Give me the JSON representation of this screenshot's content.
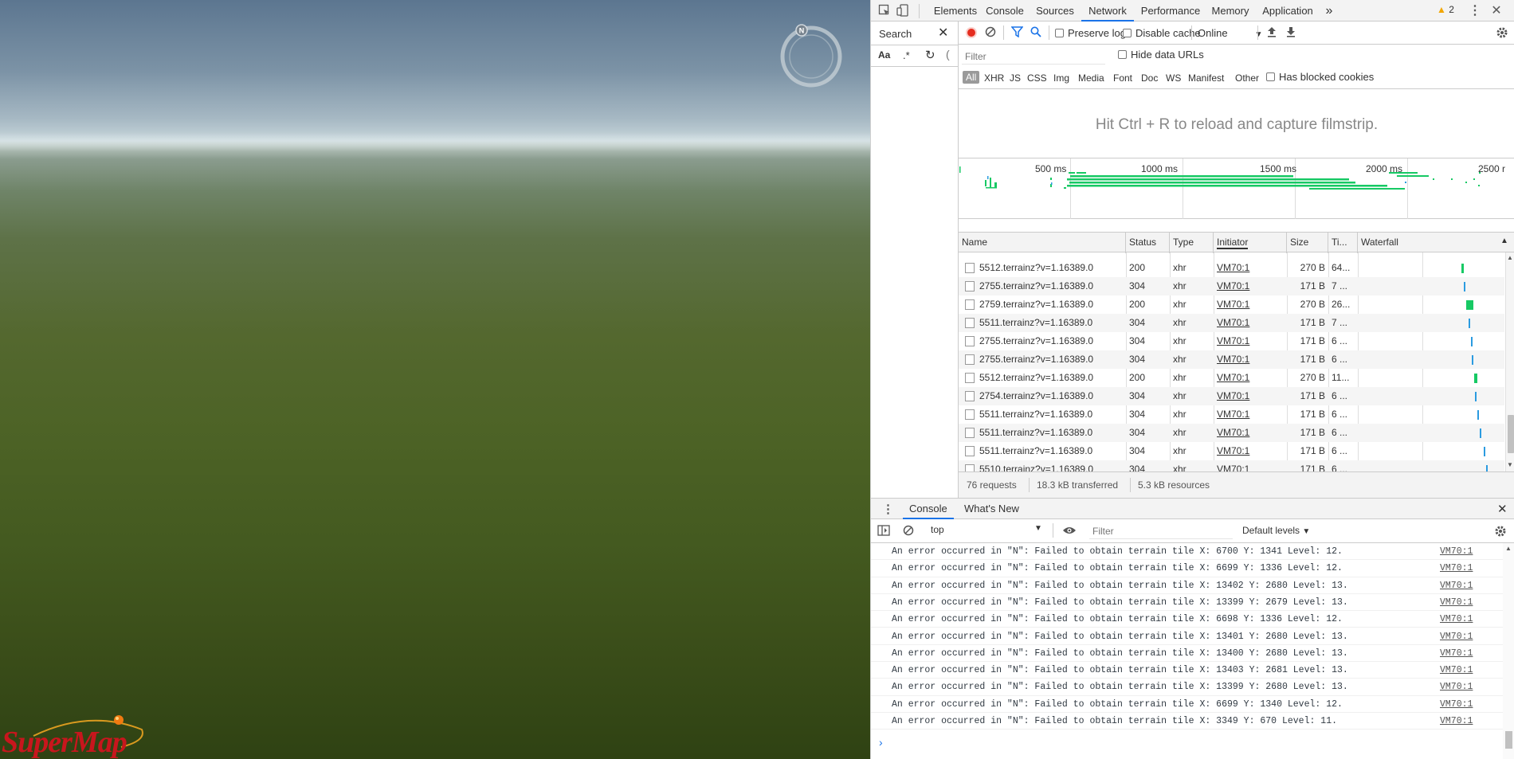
{
  "scene": {
    "compass_letter": "N",
    "logo_text": "SuperMap"
  },
  "devtools": {
    "tabs": [
      "Elements",
      "Console",
      "Sources",
      "Network",
      "Performance",
      "Memory",
      "Application"
    ],
    "active_tab": "Network",
    "more_tabs": "»",
    "warning_count": "2",
    "search": {
      "label": "Search",
      "case_toggle": "Aa",
      "regex_toggle": ".*"
    },
    "network": {
      "preserve_log": "Preserve log",
      "disable_cache": "Disable cache",
      "throttling": "Online",
      "filter_placeholder": "Filter",
      "hide_data_urls": "Hide data URLs",
      "type_filters": [
        "All",
        "XHR",
        "JS",
        "CSS",
        "Img",
        "Media",
        "Font",
        "Doc",
        "WS",
        "Manifest",
        "Other"
      ],
      "has_blocked_cookies": "Has blocked cookies",
      "filmstrip_hint": "Hit Ctrl + R to reload and capture filmstrip.",
      "overview_ticks": [
        "500 ms",
        "1000 ms",
        "1500 ms",
        "2000 ms",
        "2500 r"
      ],
      "columns": [
        "Name",
        "Status",
        "Type",
        "Initiator",
        "Size",
        "Ti...",
        "Waterfall"
      ],
      "rows": [
        {
          "name": "5512.terrainz?v=1.16389.0",
          "status": "200",
          "type": "xhr",
          "initiator": "VM70:1",
          "size": "270 B",
          "time": "64...",
          "wf": 0.56,
          "wf_color": "#17c964",
          "wf_w": 3
        },
        {
          "name": "2755.terrainz?v=1.16389.0",
          "status": "304",
          "type": "xhr",
          "initiator": "VM70:1",
          "size": "171 B",
          "time": "7 ...",
          "wf": 0.57,
          "wf_color": "#2b9be0",
          "wf_w": 2
        },
        {
          "name": "2759.terrainz?v=1.16389.0",
          "status": "200",
          "type": "xhr",
          "initiator": "VM70:1",
          "size": "270 B",
          "time": "26...",
          "wf": 0.58,
          "wf_color": "#17c964",
          "wf_w": 9
        },
        {
          "name": "5511.terrainz?v=1.16389.0",
          "status": "304",
          "type": "xhr",
          "initiator": "VM70:1",
          "size": "171 B",
          "time": "7 ...",
          "wf": 0.59,
          "wf_color": "#2b9be0",
          "wf_w": 2
        },
        {
          "name": "2755.terrainz?v=1.16389.0",
          "status": "304",
          "type": "xhr",
          "initiator": "VM70:1",
          "size": "171 B",
          "time": "6 ...",
          "wf": 0.6,
          "wf_color": "#2b9be0",
          "wf_w": 2
        },
        {
          "name": "2755.terrainz?v=1.16389.0",
          "status": "304",
          "type": "xhr",
          "initiator": "VM70:1",
          "size": "171 B",
          "time": "6 ...",
          "wf": 0.6,
          "wf_color": "#2b9be0",
          "wf_w": 2
        },
        {
          "name": "5512.terrainz?v=1.16389.0",
          "status": "200",
          "type": "xhr",
          "initiator": "VM70:1",
          "size": "270 B",
          "time": "11...",
          "wf": 0.61,
          "wf_color": "#17c964",
          "wf_w": 4
        },
        {
          "name": "2754.terrainz?v=1.16389.0",
          "status": "304",
          "type": "xhr",
          "initiator": "VM70:1",
          "size": "171 B",
          "time": "6 ...",
          "wf": 0.61,
          "wf_color": "#2b9be0",
          "wf_w": 2
        },
        {
          "name": "5511.terrainz?v=1.16389.0",
          "status": "304",
          "type": "xhr",
          "initiator": "VM70:1",
          "size": "171 B",
          "time": "6 ...",
          "wf": 0.62,
          "wf_color": "#2b9be0",
          "wf_w": 2
        },
        {
          "name": "5511.terrainz?v=1.16389.0",
          "status": "304",
          "type": "xhr",
          "initiator": "VM70:1",
          "size": "171 B",
          "time": "6 ...",
          "wf": 0.63,
          "wf_color": "#2b9be0",
          "wf_w": 2
        },
        {
          "name": "5511.terrainz?v=1.16389.0",
          "status": "304",
          "type": "xhr",
          "initiator": "VM70:1",
          "size": "171 B",
          "time": "6 ...",
          "wf": 0.65,
          "wf_color": "#2b9be0",
          "wf_w": 2
        },
        {
          "name": "5510.terrainz?v=1.16389.0",
          "status": "304",
          "type": "xhr",
          "initiator": "VM70:1",
          "size": "171 B",
          "time": "6 ...",
          "wf": 0.66,
          "wf_color": "#2b9be0",
          "wf_w": 2
        }
      ],
      "summary": {
        "requests": "76 requests",
        "transferred": "18.3 kB transferred",
        "resources": "5.3 kB resources"
      }
    },
    "drawer": {
      "tabs": [
        "Console",
        "What's New"
      ],
      "active_tab": "Console",
      "context": "top",
      "filter_placeholder": "Filter",
      "levels": "Default levels",
      "messages": [
        {
          "text": "An error occurred in \"N\": Failed to obtain terrain tile X: 6700 Y: 1341 Level: 12.",
          "source": "VM70:1"
        },
        {
          "text": "An error occurred in \"N\": Failed to obtain terrain tile X: 6699 Y: 1336 Level: 12.",
          "source": "VM70:1"
        },
        {
          "text": "An error occurred in \"N\": Failed to obtain terrain tile X: 13402 Y: 2680 Level: 13.",
          "source": "VM70:1"
        },
        {
          "text": "An error occurred in \"N\": Failed to obtain terrain tile X: 13399 Y: 2679 Level: 13.",
          "source": "VM70:1"
        },
        {
          "text": "An error occurred in \"N\": Failed to obtain terrain tile X: 6698 Y: 1336 Level: 12.",
          "source": "VM70:1"
        },
        {
          "text": "An error occurred in \"N\": Failed to obtain terrain tile X: 13401 Y: 2680 Level: 13.",
          "source": "VM70:1"
        },
        {
          "text": "An error occurred in \"N\": Failed to obtain terrain tile X: 13400 Y: 2680 Level: 13.",
          "source": "VM70:1"
        },
        {
          "text": "An error occurred in \"N\": Failed to obtain terrain tile X: 13403 Y: 2681 Level: 13.",
          "source": "VM70:1"
        },
        {
          "text": "An error occurred in \"N\": Failed to obtain terrain tile X: 13399 Y: 2680 Level: 13.",
          "source": "VM70:1"
        },
        {
          "text": "An error occurred in \"N\": Failed to obtain terrain tile X: 6699 Y: 1340 Level: 12.",
          "source": "VM70:1"
        },
        {
          "text": "An error occurred in \"N\": Failed to obtain terrain tile X: 3349 Y: 670 Level: 11.",
          "source": "VM70:1"
        }
      ],
      "prompt": "›"
    },
    "colors": {
      "accent": "#1a73e8",
      "record": "#e52d1f",
      "waterfall_green": "#17c964",
      "waterfall_blue": "#2b9be0"
    }
  }
}
